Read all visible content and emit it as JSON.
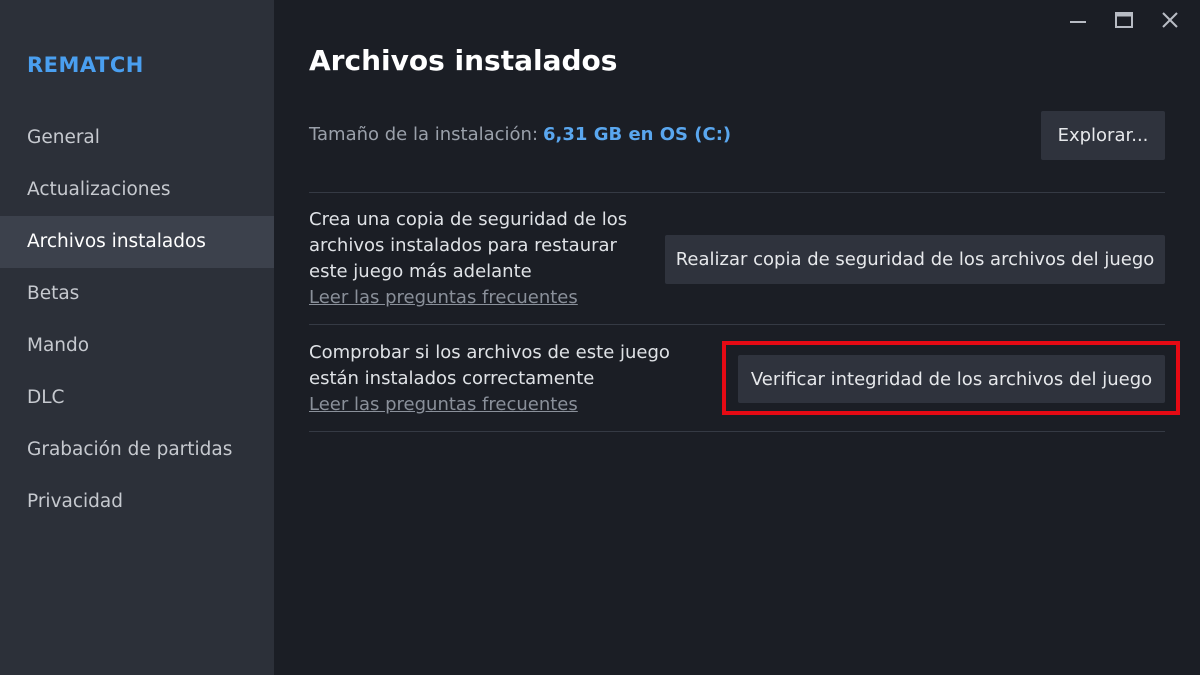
{
  "sidebar": {
    "game_title": "REMATCH",
    "items": [
      {
        "label": "General",
        "active": false
      },
      {
        "label": "Actualizaciones",
        "active": false
      },
      {
        "label": "Archivos instalados",
        "active": true
      },
      {
        "label": "Betas",
        "active": false
      },
      {
        "label": "Mando",
        "active": false
      },
      {
        "label": "DLC",
        "active": false
      },
      {
        "label": "Grabación de partidas",
        "active": false
      },
      {
        "label": "Privacidad",
        "active": false
      }
    ]
  },
  "window_controls": {
    "icons": [
      "minimize-icon",
      "maximize-icon",
      "close-icon"
    ]
  },
  "main": {
    "title": "Archivos instalados",
    "install_size_label": "Tamaño de la instalación:",
    "install_size_value": "6,31 GB en OS (C:)",
    "browse_label": "Explorar...",
    "backup": {
      "text_line1": "Crea una copia de seguridad de los",
      "text_line2": "archivos instalados para restaurar",
      "text_line3": "este juego más adelante",
      "faq_link": "Leer las preguntas frecuentes",
      "button_label": "Realizar copia de seguridad de los archivos del juego"
    },
    "verify": {
      "text_line1": "Comprobar si los archivos de este juego",
      "text_line2": "están instalados correctamente",
      "faq_link": "Leer las preguntas frecuentes",
      "button_label": "Verificar integridad de los archivos del juego"
    }
  },
  "colors": {
    "accent": "#4a9ff0",
    "highlight": "#e50a14",
    "sidebar_bg": "#2c3039",
    "main_bg": "#1b1e25"
  }
}
